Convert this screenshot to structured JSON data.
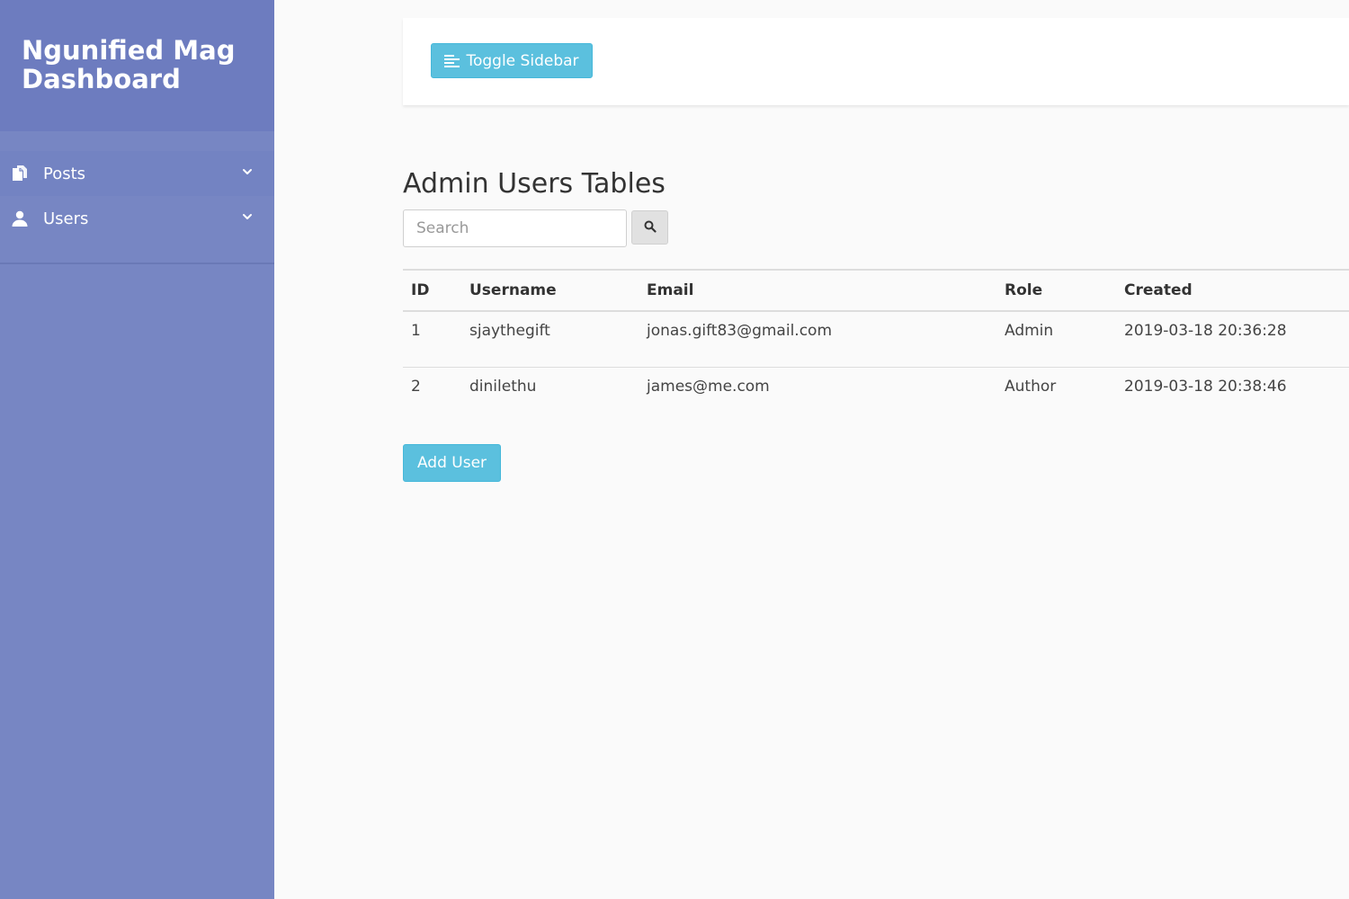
{
  "sidebar": {
    "brand_line1": "Ngunified Mag",
    "brand_line2": "Dashboard",
    "items": [
      {
        "label": "Posts",
        "icon": "files-icon"
      },
      {
        "label": "Users",
        "icon": "user-icon"
      }
    ]
  },
  "topbar": {
    "toggle_label": "Toggle Sidebar"
  },
  "main": {
    "title": "Admin Users Tables",
    "search_placeholder": "Search"
  },
  "table": {
    "headers": [
      "ID",
      "Username",
      "Email",
      "Role",
      "Created"
    ],
    "rows": [
      {
        "id": "1",
        "username": "sjaythegift",
        "email": "jonas.gift83@gmail.com",
        "role": "Admin",
        "created": "2019-03-18 20:36:28"
      },
      {
        "id": "2",
        "username": "dinilethu",
        "email": "james@me.com",
        "role": "Author",
        "created": "2019-03-18 20:38:46"
      }
    ]
  },
  "actions": {
    "add_user_label": "Add User"
  },
  "colors": {
    "sidebar_bg": "#7786c3",
    "sidebar_header_bg": "#6d7cbf",
    "info_button": "#5bc0de",
    "page_bg": "#fafafa"
  }
}
